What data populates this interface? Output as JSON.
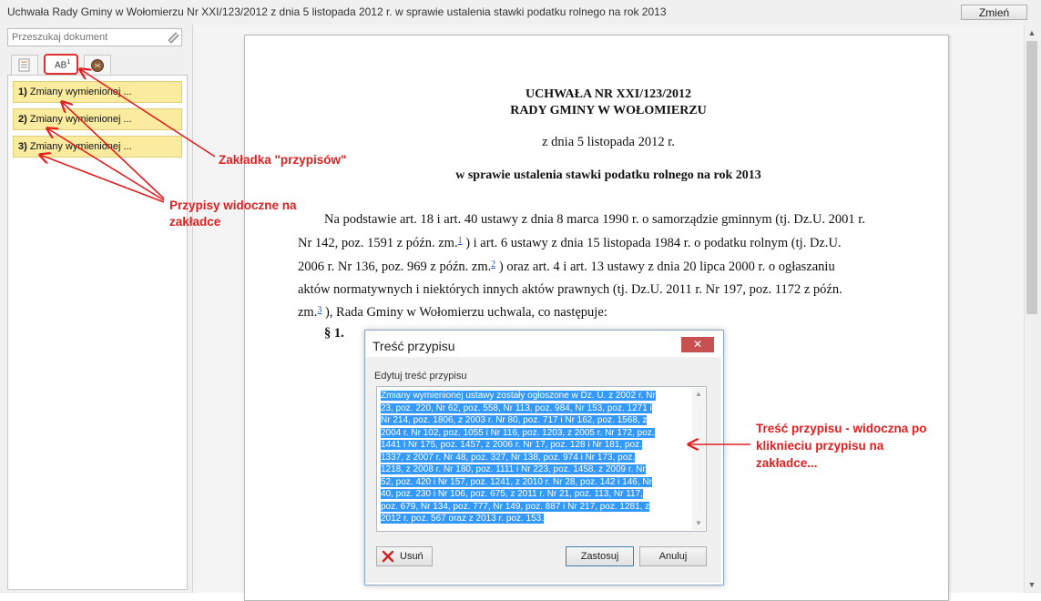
{
  "window": {
    "title": "Uchwała Rady Gminy w Wołomierzu Nr XXI/123/2012 z dnia 5 listopada 2012 r. w sprawie ustalenia stawki podatku rolnego na rok 2013",
    "change_button": "Zmień"
  },
  "sidebar": {
    "search_placeholder": "Przeszukaj dokument",
    "tabs": [
      {
        "icon": "document-list-icon"
      },
      {
        "label": "AB",
        "sup": "1",
        "icon": "footnote-icon"
      },
      {
        "icon": "notes-icon"
      }
    ],
    "footnotes": [
      {
        "num": "1)",
        "label": "Zmiany wymienionej ..."
      },
      {
        "num": "2)",
        "label": "Zmiany wymienionej ..."
      },
      {
        "num": "3)",
        "label": "Zmiany wymienionej ..."
      }
    ]
  },
  "document": {
    "heading1": "UCHWAŁA NR XXI/123/2012",
    "heading2": "RADY GMINY W WOŁOMIERZU",
    "date": "z dnia 5 listopada 2012 r.",
    "subject": "w sprawie ustalenia stawki podatku rolnego na rok 2013",
    "body_lines": [
      "Na podstawie art. 18 i art. 40 ustawy z dnia 8 marca 1990 r. o samorządzie gminnym (tj. Dz.U. 2001 r.",
      "Nr 142, poz. 1591 z późn. zm.",
      " ) i art. 6 ustawy z dnia 15 listopada 1984 r. o podatku rolnym (tj. Dz.U.",
      "2006 r. Nr 136, poz. 969 z późn. zm.",
      " ) oraz art. 4 i art. 13 ustawy z dnia 20 lipca 2000 r. o ogłaszaniu",
      "aktów normatywnych i niektórych innych aktów prawnych (tj. Dz.U. 2011 r. Nr 197, poz. 1172 z późn.",
      "zm.",
      " ), Rada Gminy w Wołomierzu uchwala, co następuje:"
    ],
    "refs": [
      "1",
      "2",
      "3"
    ],
    "paragraph_mark": "§ 1."
  },
  "dialog": {
    "title": "Treść przypisu",
    "close": "✕",
    "edit_label": "Edytuj treść przypisu",
    "text_lines": [
      "Zmiany wymienionej ustawy zostały ogłoszone w Dz. U. z 2002 r. Nr",
      "23, poz. 220, Nr 62, poz. 558, Nr 113, poz. 984, Nr 153, poz. 1271 i",
      "Nr 214, poz. 1806, z 2003 r. Nr 80, poz. 717 i Nr 162, poz. 1568, z",
      "2004 r. Nr 102, poz. 1055 i Nr 116, poz. 1203, z 2005 r. Nr 172, poz.",
      "1441 i Nr 175, poz. 1457, z 2006 r. Nr 17, poz. 128 i Nr 181, poz.",
      "1337, z 2007 r. Nr 48, poz. 327, Nr 138, poz. 974 i Nr 173, poz.",
      "1218, z 2008 r. Nr 180, poz. 1111 i Nr 223, poz. 1458, z 2009 r. Nr",
      "52, poz. 420 i Nr 157, poz. 1241, z 2010 r. Nr 28, poz. 142 i 146, Nr",
      "40, poz. 230 i Nr 106, poz. 675, z 2011 r. Nr 21, poz. 113, Nr 117,",
      "poz. 679, Nr 134, poz. 777, Nr 149, poz. 887 i Nr 217, poz. 1281, z",
      "2012 r. poz. 567 oraz z 2013 r. poz. 153."
    ],
    "delete_label": "Usuń",
    "apply_label": "Zastosuj",
    "cancel_label": "Anuluj"
  },
  "annotations": {
    "tab_note": "Zakładka \"przypisów\"",
    "list_note_line1": "Przypisy widoczne na",
    "list_note_line2": "zakładce",
    "content_note_line1": "Treść przypisu - widoczna po",
    "content_note_line2": "kliknieciu przypisu na",
    "content_note_line3": "zakładce...",
    "color": "#e02020"
  }
}
